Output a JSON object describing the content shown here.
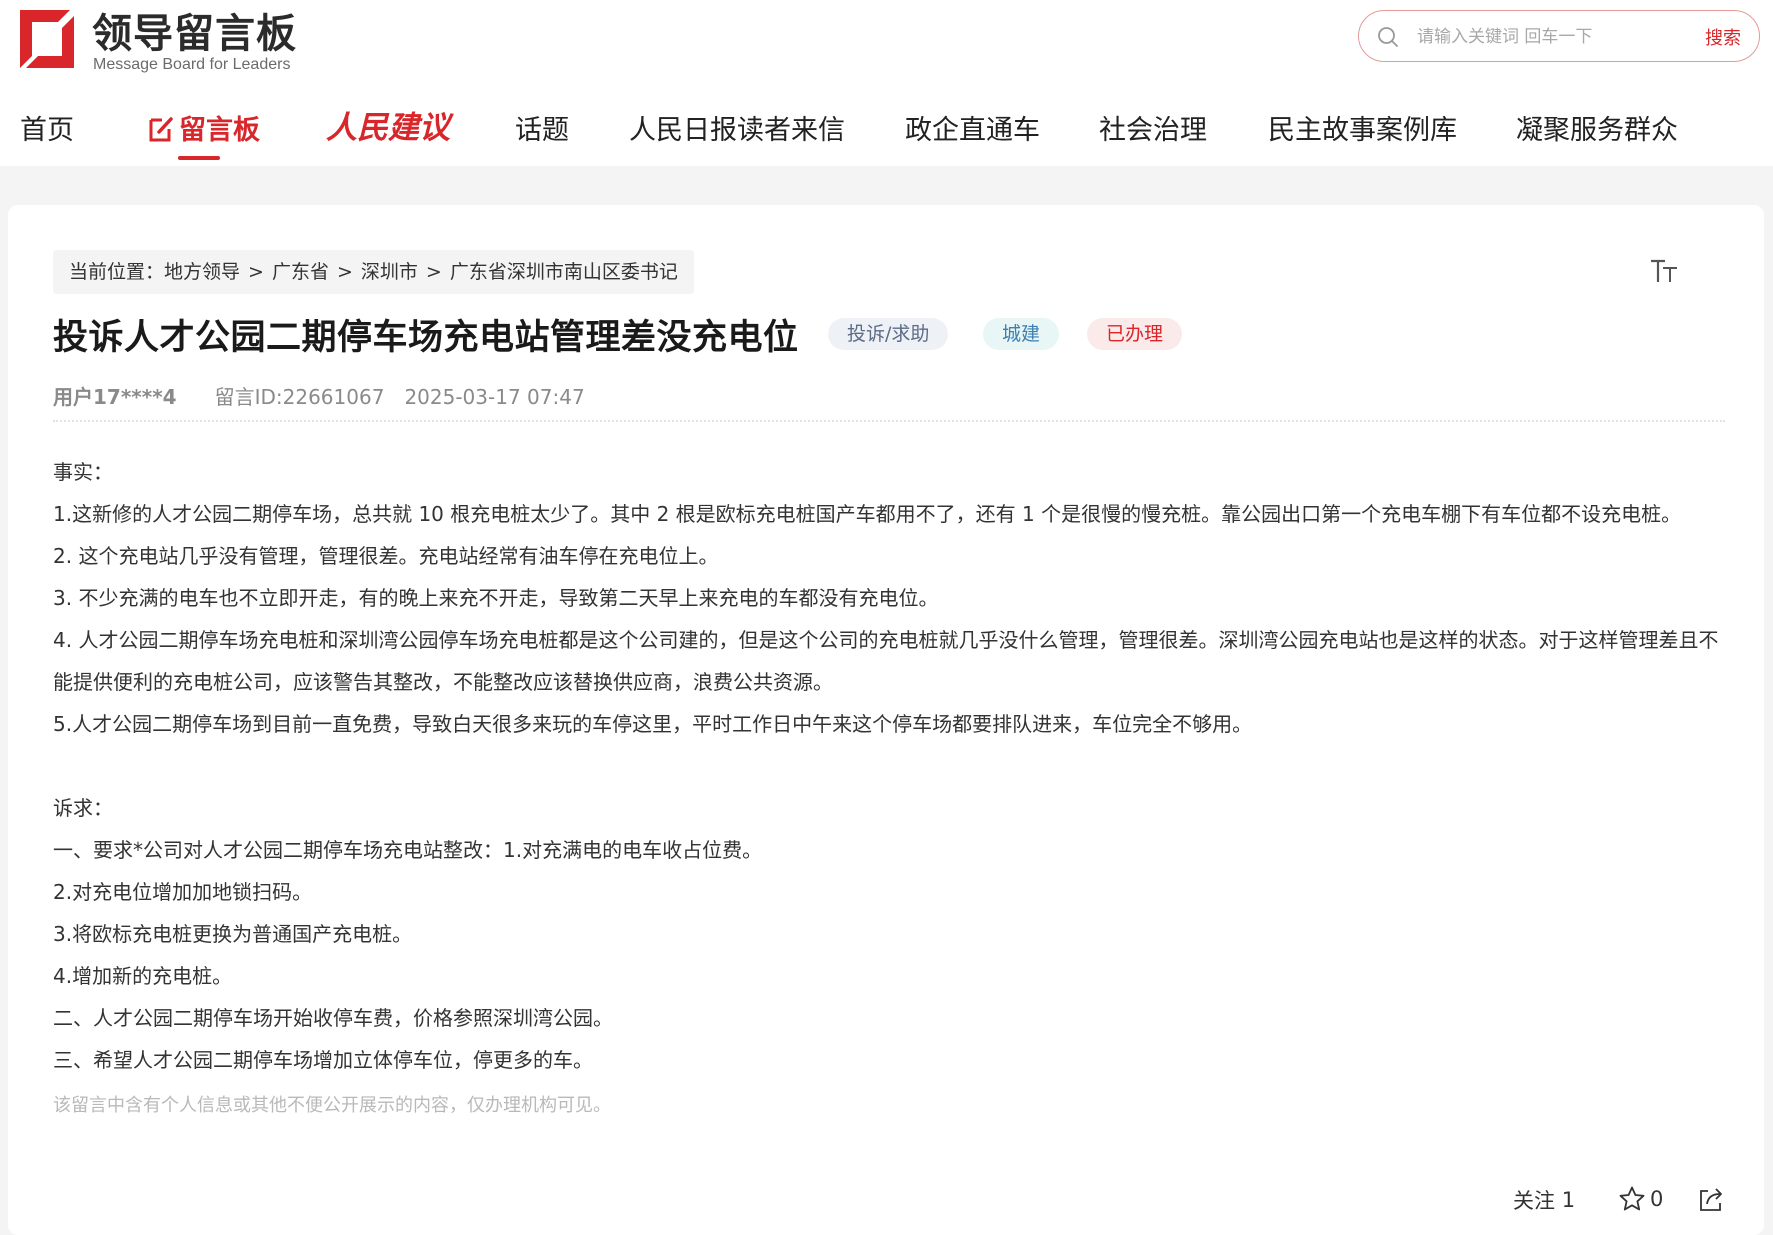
{
  "header": {
    "logo_title": "领导留言板",
    "logo_subtitle": "Message Board for Leaders",
    "search": {
      "placeholder": "请输入关键词 回车一下",
      "button": "搜索"
    }
  },
  "nav": {
    "items": [
      "首页",
      "留言板",
      "人民建议",
      "话题",
      "人民日报读者来信",
      "政企直通车",
      "社会治理",
      "民主故事案例库",
      "凝聚服务群众"
    ],
    "active": "留言板"
  },
  "breadcrumb": {
    "prefix": "当前位置：",
    "items": [
      "地方领导",
      "广东省",
      "深圳市",
      "广东省深圳市南山区委书记"
    ],
    "separator": ">"
  },
  "message": {
    "title": "投诉人才公园二期停车场充电站管理差没充电位",
    "tags": {
      "type": "投诉/求助",
      "field": "城建",
      "status": "已办理"
    },
    "user": "用户17****4",
    "id": "留言ID:22661067",
    "datetime": "2025-03-17 07:47",
    "paragraphs": [
      "事实：",
      "1.这新修的人才公园二期停车场，总共就 10 根充电桩太少了。其中 2 根是欧标充电桩国产车都用不了，还有 1 个是很慢的慢充桩。靠公园出口第一个充电车棚下有车位都不设充电桩。",
      "2. 这个充电站几乎没有管理，管理很差。充电站经常有油车停在充电位上。",
      "3. 不少充满的电车也不立即开走，有的晚上来充不开走，导致第二天早上来充电的车都没有充电位。",
      "4. 人才公园二期停车场充电桩和深圳湾公园停车场充电桩都是这个公司建的，但是这个公司的充电桩就几乎没什么管理，管理很差。深圳湾公园充电站也是这样的状态。对于这样管理差且不能提供便利的充电桩公司，应该警告其整改，不能整改应该替换供应商，浪费公共资源。",
      "5.人才公园二期停车场到目前一直免费，导致白天很多来玩的车停这里，平时工作日中午来这个停车场都要排队进来，车位完全不够用。"
    ],
    "demands": [
      "诉求：",
      "一、要求*公司对人才公园二期停车场充电站整改：1.对充满电的电车收占位费。",
      "2.对充电位增加加地锁扫码。",
      "3.将欧标充电桩更换为普通国产充电桩。",
      "4.增加新的充电桩。",
      "二、人才公园二期停车场开始收停车费，价格参照深圳湾公园。",
      "三、希望人才公园二期停车场增加立体停车位，停更多的车。"
    ],
    "privacy_notice": "该留言中含有个人信息或其他不便公开展示的内容，仅办理机构可见。"
  },
  "actions": {
    "follow_label": "关注",
    "follow_count": "1",
    "star_count": "0"
  },
  "colors": {
    "brand_red": "#d8262a",
    "page_bg": "#f4f4f5",
    "card_bg": "#ffffff"
  },
  "icons": [
    "logo-icon",
    "search-icon",
    "edit-icon",
    "font-size-icon",
    "star-icon",
    "share-icon"
  ]
}
